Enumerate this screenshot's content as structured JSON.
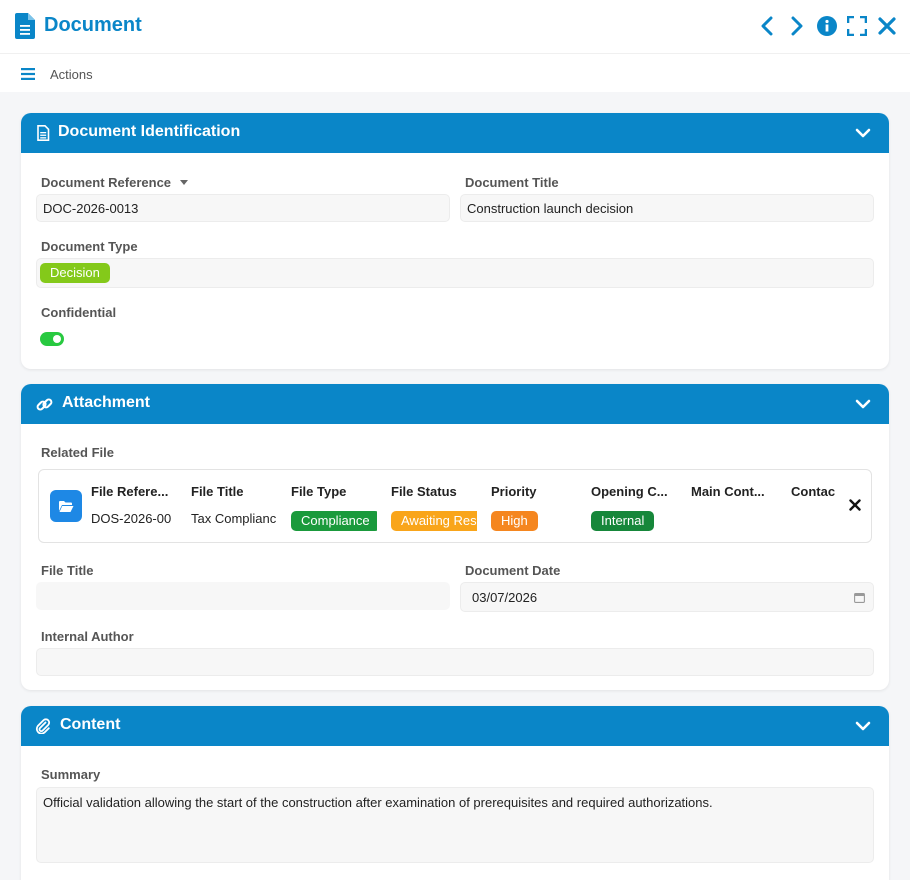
{
  "window": {
    "title": "Document",
    "actions_label": "Actions"
  },
  "colors": {
    "brand": "#0a86c8",
    "tag_decision": "#84c91a",
    "tag_compliance": "#1a9a3c",
    "tag_awaiting": "#f9a51a",
    "tag_high": "#f5861f",
    "tag_internal": "#16873a",
    "toggle_on": "#28c940"
  },
  "identification": {
    "title": "Document Identification",
    "reference_label": "Document Reference",
    "reference_value": "DOC-2026-0013",
    "doc_title_label": "Document Title",
    "doc_title_value": "Construction launch decision",
    "type_label": "Document Type",
    "type_value": "Decision",
    "confidential_label": "Confidential",
    "confidential": true
  },
  "attachment": {
    "title": "Attachment",
    "related_file_label": "Related File",
    "file_card": {
      "columns": [
        {
          "header": "File Refere...",
          "value": "DOS-2026-00"
        },
        {
          "header": "File Title",
          "value": "Tax Complianc"
        },
        {
          "header": "File Type",
          "value": "Compliance"
        },
        {
          "header": "File Status",
          "value": "Awaiting Res"
        },
        {
          "header": "Priority",
          "value": "High"
        },
        {
          "header": "Opening C...",
          "value": "Internal"
        },
        {
          "header": "Main Cont...",
          "value": ""
        },
        {
          "header": "Contac",
          "value": ""
        }
      ]
    },
    "file_title_label": "File Title",
    "file_title_value": "",
    "document_date_label": "Document Date",
    "document_date_value": "03/07/2026",
    "internal_author_label": "Internal Author",
    "internal_author_value": ""
  },
  "content": {
    "title": "Content",
    "summary_label": "Summary",
    "summary_value": "Official validation allowing the start of the construction after examination of prerequisites and required authorizations."
  },
  "icons": {
    "title": "document-icon",
    "prev": "chevron-left-icon",
    "next": "chevron-right-icon",
    "info": "info-icon",
    "fullscreen": "fullscreen-icon",
    "close": "close-icon",
    "menu": "hamburger-menu-icon",
    "section_identification": "document-lines-icon",
    "section_attachment": "link-icon",
    "section_content": "paperclip-icon",
    "collapse": "chevron-down-icon",
    "file": "folder-open-icon",
    "calendar": "calendar-icon",
    "remove": "remove-x-icon"
  }
}
